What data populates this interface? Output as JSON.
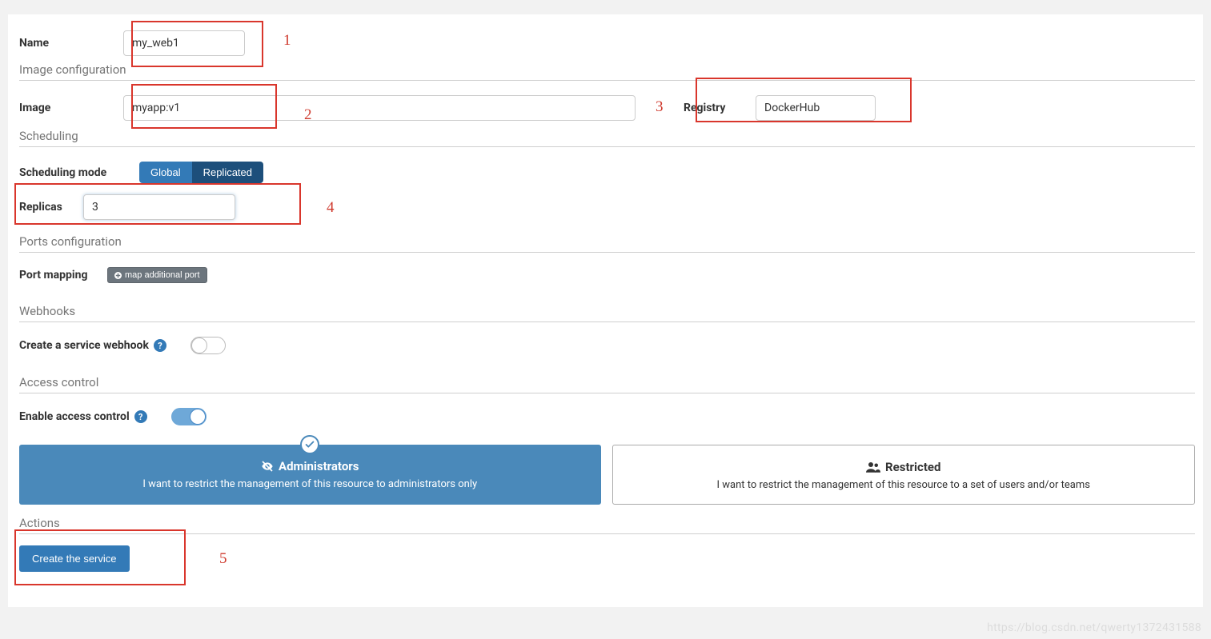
{
  "labels": {
    "name": "Name",
    "image": "Image",
    "registry": "Registry",
    "scheduling_mode": "Scheduling mode",
    "replicas": "Replicas",
    "port_mapping": "Port mapping",
    "create_webhook": "Create a service webhook",
    "enable_access_control": "Enable access control"
  },
  "sections": {
    "image_config": "Image configuration",
    "scheduling": "Scheduling",
    "ports_config": "Ports configuration",
    "webhooks": "Webhooks",
    "access_control": "Access control",
    "actions": "Actions"
  },
  "values": {
    "name": "my_web1",
    "image": "myapp:v1",
    "registry": "DockerHub",
    "replicas": "3"
  },
  "scheduling_options": {
    "global": "Global",
    "replicated": "Replicated"
  },
  "buttons": {
    "map_port": "map additional port",
    "create_service": "Create the service"
  },
  "access_cards": {
    "admin_title": "Administrators",
    "admin_desc": "I want to restrict the management of this resource to administrators only",
    "restricted_title": "Restricted",
    "restricted_desc": "I want to restrict the management of this resource to a set of users and/or teams"
  },
  "annotations": {
    "n1": "1",
    "n2": "2",
    "n3": "3",
    "n4": "4",
    "n5": "5"
  },
  "watermark": "https://blog.csdn.net/qwerty1372431588"
}
